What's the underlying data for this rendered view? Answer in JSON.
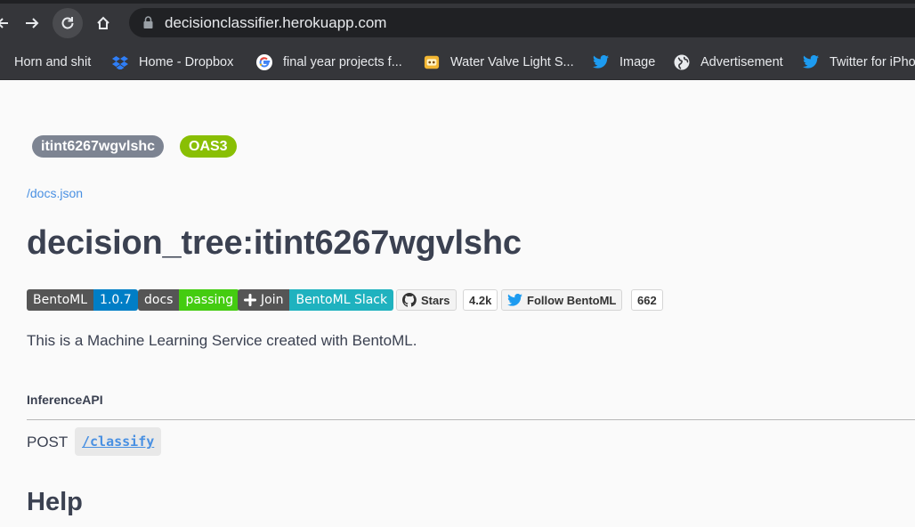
{
  "browser": {
    "url": "decisionclassifier.herokuapp.com",
    "bookmarks": [
      {
        "label": "Horn and shit",
        "icon": "folder-icon"
      },
      {
        "label": "Home - Dropbox",
        "icon": "dropbox-icon"
      },
      {
        "label": "final year projects f...",
        "icon": "google-icon"
      },
      {
        "label": "Water Valve Light S...",
        "icon": "bentoml-icon"
      },
      {
        "label": "Image",
        "icon": "twitter-icon"
      },
      {
        "label": "Advertisement",
        "icon": "globe-icon"
      },
      {
        "label": "Twitter for iPho",
        "icon": "twitter-icon"
      }
    ]
  },
  "page": {
    "version_pill": "itint6267wgvlshc",
    "oas_pill": "OAS3",
    "docs_link": "/docs.json",
    "title": "decision_tree:itint6267wgvlshc",
    "badges": {
      "bentoml_left": "BentoML",
      "bentoml_right": "1.0.7",
      "docs_left": "docs",
      "docs_right": "passing",
      "slack_left": "Join",
      "slack_right": "BentoML Slack",
      "stars_label": "Stars",
      "stars_count": "4.2k",
      "follow_label": "Follow BentoML",
      "follow_count": "662"
    },
    "description": "This is a Machine Learning Service created with BentoML.",
    "section_title": "InferenceAPI",
    "method": "POST",
    "endpoint": "/classify",
    "help_heading": "Help"
  },
  "colors": {
    "oas_green": "#89bf04",
    "version_gray": "#7d8492",
    "link_blue": "#4990e2",
    "bentoml_blue": "#007ec6",
    "docs_green": "#4c1",
    "slack_teal": "#1fb2bf"
  }
}
